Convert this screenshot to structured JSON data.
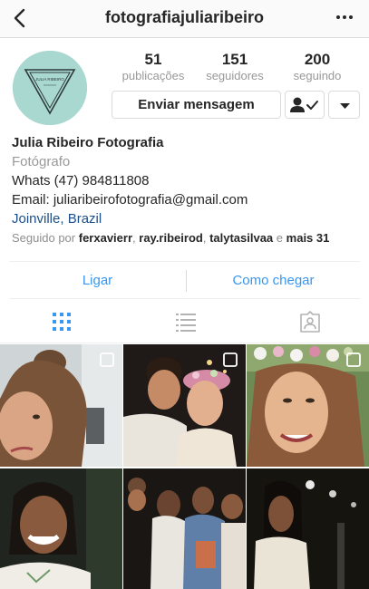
{
  "header": {
    "username": "fotografiajuliaribeiro",
    "back_icon": "chevron-left-icon",
    "more_icon": "ellipsis-icon"
  },
  "avatar": {
    "logo_text": "JULIA RIBEIRO",
    "bg_color": "#a8d8d0"
  },
  "stats": [
    {
      "value": "51",
      "label": "publicações"
    },
    {
      "value": "151",
      "label": "seguidores"
    },
    {
      "value": "200",
      "label": "seguindo"
    }
  ],
  "buttons": {
    "message": "Enviar mensagem",
    "following_icon": "user-check-icon",
    "dropdown_icon": "caret-down-icon"
  },
  "bio": {
    "name": "Julia Ribeiro Fotografia",
    "category": "Fotógrafo",
    "phone": "Whats (47) 984811808",
    "email": "Email: juliaribeirofotografia@gmail.com",
    "location": "Joinville, Brazil"
  },
  "followed_by": {
    "prefix": "Seguido por",
    "users": [
      "ferxavierr",
      "ray.ribeirod",
      "talytasilvaa"
    ],
    "conj": "e",
    "more": "mais 31"
  },
  "actions": {
    "call": "Ligar",
    "directions": "Como chegar"
  },
  "tabs": [
    {
      "icon": "grid-icon",
      "active": true
    },
    {
      "icon": "list-icon",
      "active": false
    },
    {
      "icon": "tagged-icon",
      "active": false
    }
  ],
  "posts": [
    {
      "multi": true
    },
    {
      "multi": true
    },
    {
      "multi": true
    },
    {
      "multi": false
    },
    {
      "multi": false
    },
    {
      "multi": false
    }
  ],
  "colors": {
    "link": "#3897f0",
    "location": "#1d4f8a",
    "muted": "#999999",
    "text": "#262626"
  }
}
